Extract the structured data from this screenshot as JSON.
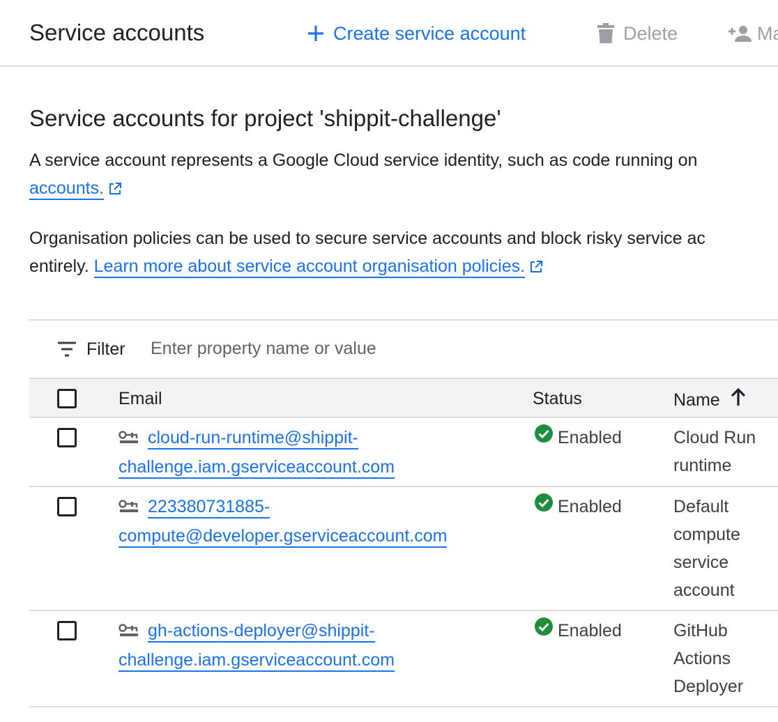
{
  "header": {
    "title": "Service accounts",
    "create_label": "Create service account",
    "delete_label": "Delete",
    "manage_label": "Ma",
    "accent_color": "#1a73e8",
    "disabled_color": "#9aa0a6"
  },
  "main": {
    "heading": "Service accounts for project 'shippit-challenge'",
    "para1_text": "A service account represents a Google Cloud service identity, such as code running on",
    "para1_link": "accounts.",
    "para2_text": "Organisation policies can be used to secure service accounts and block risky service ac",
    "para2_prefix": "entirely.",
    "para2_link": "Learn more about service account organisation policies."
  },
  "filter": {
    "label": "Filter",
    "placeholder": "Enter property name or value"
  },
  "table": {
    "columns": {
      "email": "Email",
      "status": "Status",
      "name": "Name"
    },
    "sort_icon": "arrow-up-icon",
    "rows": [
      {
        "email_line1": "cloud-run-runtime@shippit-",
        "email_line2": "challenge.iam.gserviceaccount.com",
        "status": "Enabled",
        "name": "Cloud Run runtime"
      },
      {
        "email_line1": "223380731885-",
        "email_line2": "compute@developer.gserviceaccount.com",
        "status": "Enabled",
        "name": "Default compute service account"
      },
      {
        "email_line1": "gh-actions-deployer@shippit-",
        "email_line2": "challenge.iam.gserviceaccount.com",
        "status": "Enabled",
        "name": "GitHub Actions Deployer"
      }
    ]
  },
  "icons": {
    "create": "plus-icon",
    "delete": "trash-icon",
    "manage": "person-add-icon",
    "external_link": "external-link-icon",
    "filter": "filter-lines-icon",
    "service_account": "key-card-icon",
    "status_ok": "check-circle-icon",
    "status_color": "#1e8e3e"
  }
}
